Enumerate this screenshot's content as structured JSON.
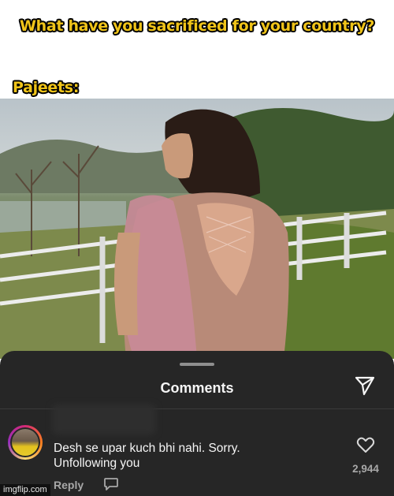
{
  "meme": {
    "top_caption": "What have you sacrificed for your country?",
    "mid_caption": "Pajeets:"
  },
  "comments_sheet": {
    "title": "Comments",
    "icons": {
      "share": "send-icon",
      "like": "heart-icon",
      "reply": "speech-bubble-icon"
    },
    "comment": {
      "text": "Desh se upar kuch bhi nahi.  Sorry. Unfollowing you",
      "likes": "2,944",
      "reply_label": "Reply"
    }
  },
  "watermark": "imgflip.com",
  "colors": {
    "caption_fill": "#f0c419",
    "sheet_background": "#262626"
  }
}
